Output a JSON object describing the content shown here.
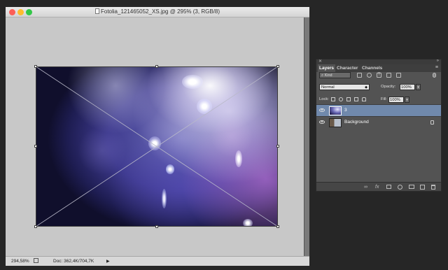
{
  "document": {
    "title": "Fotolia_121465052_XS.jpg @ 295% (3, RGB/8)",
    "zoom": "294,58%",
    "doc_size": "Doc: 362,4K/704,7K"
  },
  "window_controls": {
    "close_color": "#fc5f57",
    "minimize_color": "#fdbc2e",
    "zoom_color": "#33c748"
  },
  "layers_panel": {
    "tabs": [
      "Layers",
      "Character",
      "Channels"
    ],
    "filter_kind": "Kind",
    "blend_mode": "Normal",
    "opacity_label": "Opacity:",
    "opacity_value": "100%",
    "lock_label": "Lock:",
    "fill_label": "Fill:",
    "fill_value": "100%",
    "layers": [
      {
        "name": "3",
        "selected": true,
        "visible": true
      },
      {
        "name": "Background",
        "selected": false,
        "visible": true,
        "locked": true
      }
    ],
    "bottom_icons": [
      "link-icon",
      "fx-icon",
      "mask-icon",
      "adjustment-icon",
      "group-icon",
      "new-layer-icon",
      "trash-icon"
    ]
  },
  "colors": {
    "selected_layer": "#7089ac",
    "panel_bg": "#535353",
    "canvas_bg": "#c8c8c8"
  }
}
